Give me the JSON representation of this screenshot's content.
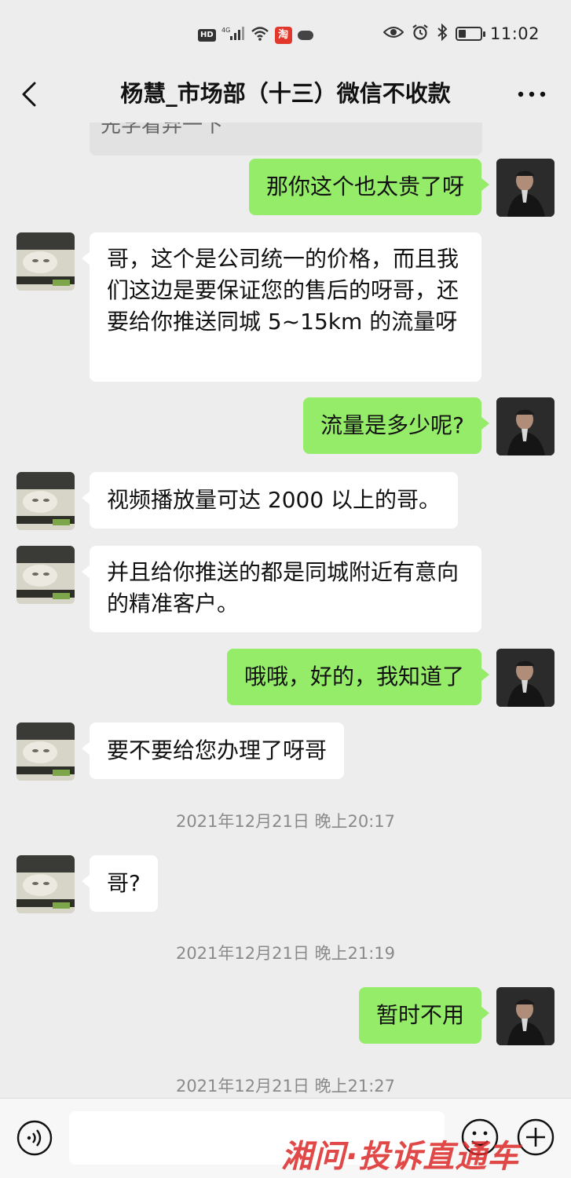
{
  "status_bar": {
    "hd": "HD",
    "signal": "4G",
    "taobao_glyph": "淘",
    "time": "11:02",
    "icons": [
      "signal-icon",
      "wifi-icon",
      "taobao-icon",
      "cloud-icon",
      "eye-icon",
      "alarm-icon",
      "bluetooth-icon",
      "battery-icon"
    ]
  },
  "header": {
    "title": "杨慧_市场部（十三）微信不收款",
    "back_icon": "chevron-left-icon",
    "more_icon": "more-icon"
  },
  "chat": {
    "partial_top_text": "先学看弃一下",
    "messages": [
      {
        "side": "me",
        "text": "那你这个也太贵了呀"
      },
      {
        "side": "them",
        "text": "哥，这个是公司统一的价格，而且我们这边是要保证您的售后的呀哥，还要给你推送同城 5~15km 的流量呀"
      },
      {
        "side": "me",
        "text": "流量是多少呢?"
      },
      {
        "side": "them",
        "text": "视频播放量可达 2000 以上的哥。"
      },
      {
        "side": "them",
        "text": "并且给你推送的都是同城附近有意向的精准客户。"
      },
      {
        "side": "me",
        "text": "哦哦，好的，我知道了"
      },
      {
        "side": "them",
        "text": "要不要给您办理了呀哥"
      },
      {
        "side": "time",
        "text": "2021年12月21日 晚上20:17"
      },
      {
        "side": "them",
        "text": "哥?"
      },
      {
        "side": "time",
        "text": "2021年12月21日 晚上21:19"
      },
      {
        "side": "me",
        "text": "暂时不用"
      },
      {
        "side": "time",
        "text": "2021年12月21日 晚上21:27"
      }
    ]
  },
  "input_bar": {
    "voice_icon": "voice-icon",
    "emoji_icon": "emoji-icon",
    "plus_icon": "plus-icon"
  },
  "watermark": "湘问·投诉直通车"
}
